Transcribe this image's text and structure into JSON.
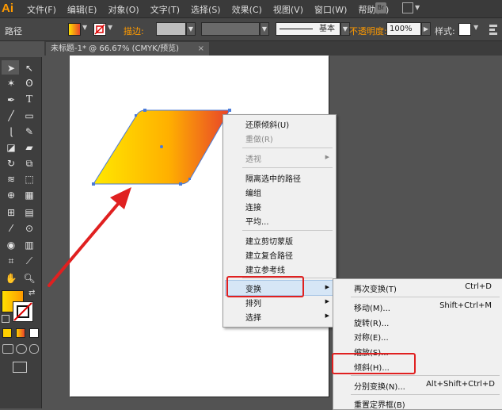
{
  "app": {
    "logo": "Ai",
    "menus": [
      "文件(F)",
      "编辑(E)",
      "对象(O)",
      "文字(T)",
      "选择(S)",
      "效果(C)",
      "视图(V)",
      "窗口(W)",
      "帮助(H)"
    ],
    "bridge_label": "Br"
  },
  "control_bar": {
    "selection_label": "路径",
    "stroke_label": "描边:",
    "brush_label": "基本",
    "opacity_label": "不透明度:",
    "opacity_value": "100%",
    "style_label": "样式:"
  },
  "document_tab": {
    "title": "未标题-1* @ 66.67% (CMYK/预览)",
    "close": "×"
  },
  "context_menu": {
    "items": [
      {
        "label": "还原倾斜(U)",
        "enabled": true
      },
      {
        "label": "重做(R)",
        "enabled": false
      },
      {
        "label": "透视",
        "enabled": false,
        "submenu": true
      },
      {
        "label": "隔离选中的路径",
        "enabled": true
      },
      {
        "label": "编组",
        "enabled": true
      },
      {
        "label": "连接",
        "enabled": true
      },
      {
        "label": "平均...",
        "enabled": true
      },
      {
        "label": "建立剪切蒙版",
        "enabled": true
      },
      {
        "label": "建立复合路径",
        "enabled": true
      },
      {
        "label": "建立参考线",
        "enabled": true
      },
      {
        "label": "变换",
        "enabled": true,
        "submenu": true,
        "highlighted": true
      },
      {
        "label": "排列",
        "enabled": true,
        "submenu": true
      },
      {
        "label": "选择",
        "enabled": true,
        "submenu": true
      }
    ]
  },
  "transform_submenu": {
    "items": [
      {
        "label": "再次变换(T)",
        "shortcut": "Ctrl+D"
      },
      {
        "label": "移动(M)...",
        "shortcut": "Shift+Ctrl+M"
      },
      {
        "label": "旋转(R)...",
        "shortcut": ""
      },
      {
        "label": "对称(E)...",
        "shortcut": ""
      },
      {
        "label": "缩放(S)...",
        "shortcut": ""
      },
      {
        "label": "倾斜(H)...",
        "shortcut": ""
      },
      {
        "label": "分别变换(N)...",
        "shortcut": "Alt+Shift+Ctrl+D"
      },
      {
        "label": "重置定界框(B)",
        "shortcut": ""
      }
    ]
  },
  "colors": {
    "gradient_start": "#ffe000",
    "gradient_end": "#e8432a",
    "annotation_red": "#e02020",
    "selection_blue": "#4a7bd8"
  }
}
